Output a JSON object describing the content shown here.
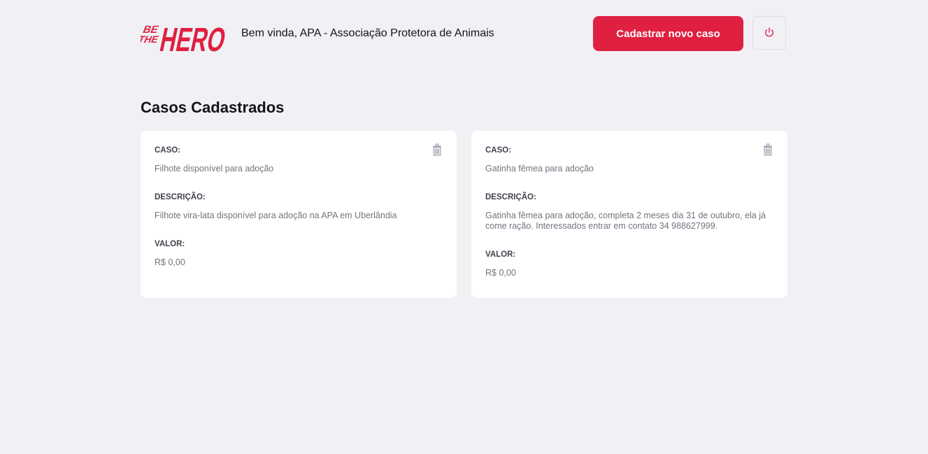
{
  "header": {
    "logo_text": {
      "be": "BE",
      "the": "THE",
      "hero": "HERO"
    },
    "welcome": "Bem vinda, APA - Associação Protetora de Animais",
    "new_case_button": "Cadastrar novo caso",
    "logout_icon": "power-icon"
  },
  "title": "Casos Cadastrados",
  "colors": {
    "brand": "#E02041",
    "background": "#F0F0F5",
    "card": "#FFFFFF",
    "label": "#41414D",
    "value": "#737380"
  },
  "cases": [
    {
      "case_label": "CASO:",
      "case": "Filhote disponível para adoção",
      "description_label": "DESCRIÇÃO:",
      "description": "Filhote vira-lata disponível para adoção na APA em Uberlândia",
      "value_label": "VALOR:",
      "value": "R$ 0,00",
      "delete_icon": "trash-icon"
    },
    {
      "case_label": "CASO:",
      "case": "Gatinha fêmea para adoção",
      "description_label": "DESCRIÇÃO:",
      "description": "Gatinha fêmea para adoção, completa 2 meses dia 31 de outubro, ela já come ração. Interessados entrar em contato 34 988627999.",
      "value_label": "VALOR:",
      "value": "R$ 0,00",
      "delete_icon": "trash-icon"
    }
  ]
}
